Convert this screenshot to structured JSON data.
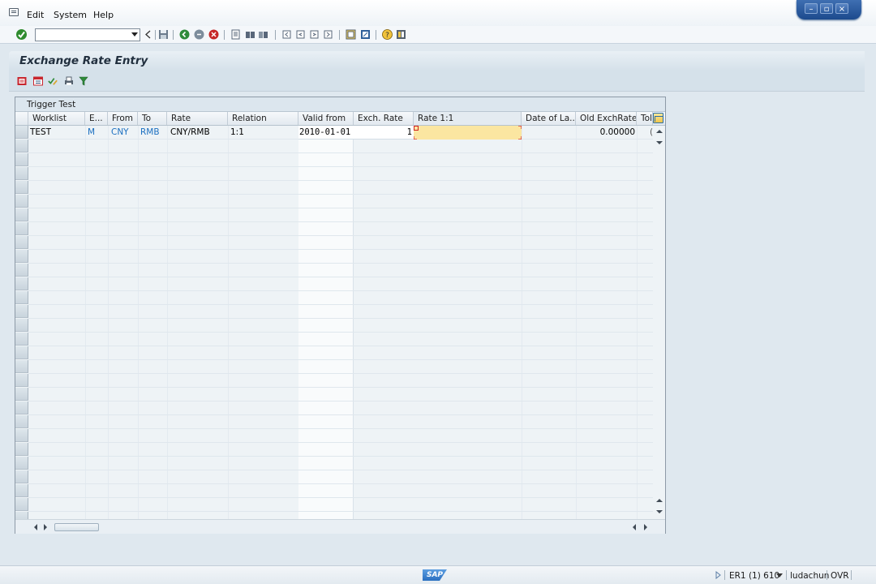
{
  "menu": {
    "items": [
      {
        "label": "Edit"
      },
      {
        "label": "System"
      },
      {
        "label": "Help"
      }
    ]
  },
  "window_controls": [
    "minimize",
    "restore",
    "close"
  ],
  "command_field": {
    "value": "",
    "placeholder": ""
  },
  "title": "Exchange Rate Entry",
  "grid": {
    "title": "Trigger Test",
    "columns": [
      "Worklist",
      "E...",
      "From",
      "To",
      "Rate",
      "Relation",
      "Valid from",
      "Exch. Rate",
      "Rate 1:1",
      "Date of La...",
      "Old ExchRate",
      "Tol"
    ],
    "rows": [
      {
        "worklist": "TEST",
        "e": "M",
        "from": "CNY",
        "to": "RMB",
        "rate": "CNY/RMB",
        "relation": "1:1",
        "valid_from": "2010-01-01",
        "exch_rate": "1",
        "rate_1_1": "",
        "date_of_last": "",
        "old_exch_rate": "0.00000",
        "tol": "("
      }
    ]
  },
  "status": {
    "system": "ER1 (1) 610",
    "user": "ludachun",
    "mode": "OVR",
    "logo": "SAP"
  },
  "colors": {
    "accent_blue": "#1b6fc0",
    "focus_cell": "#fbe6a1",
    "background": "#dfe8ef"
  }
}
